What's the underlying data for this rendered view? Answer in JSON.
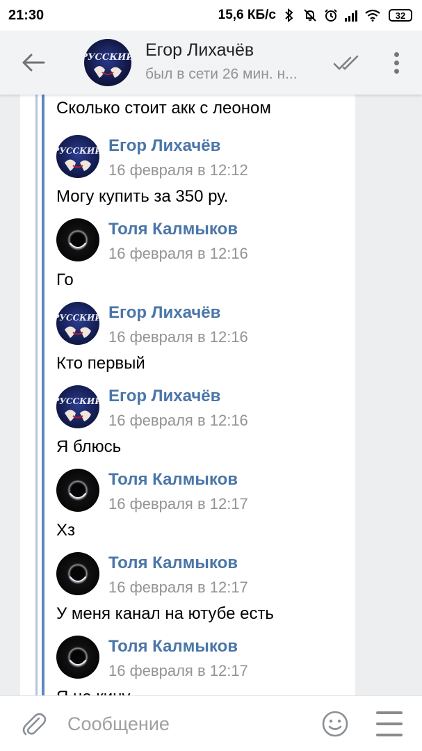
{
  "status_bar": {
    "time": "21:30",
    "network_speed": "15,6 КБ/с",
    "battery": "32",
    "icons": [
      "bluetooth-icon",
      "mute-icon",
      "alarm-icon",
      "signal-icon",
      "wifi-icon",
      "battery-icon"
    ]
  },
  "header": {
    "contact_name": "Егор Лихачёв",
    "contact_status": "был в сети 26 мин. н...",
    "avatar_text": "РУССКИЙ"
  },
  "chat": {
    "partial_top_text": "Сколько стоит акк с леоном",
    "messages": [
      {
        "author": "Егор Лихачёв",
        "date": "16 февраля в 12:12",
        "text": "Могу купить за 350 ру.",
        "avatar": "egor"
      },
      {
        "author": "Толя Калмыков",
        "date": "16 февраля в 12:16",
        "text": "Го",
        "avatar": "tolya"
      },
      {
        "author": "Егор Лихачёв",
        "date": "16 февраля в 12:16",
        "text": "Кто первый",
        "avatar": "egor"
      },
      {
        "author": "Егор Лихачёв",
        "date": "16 февраля в 12:16",
        "text": "Я блюсь",
        "avatar": "egor"
      },
      {
        "author": "Толя Калмыков",
        "date": "16 февраля в 12:17",
        "text": "Хз",
        "avatar": "tolya"
      },
      {
        "author": "Толя Калмыков",
        "date": "16 февраля в 12:17",
        "text": "У меня канал на ютубе есть",
        "avatar": "tolya"
      },
      {
        "author": "Толя Калмыков",
        "date": "16 февраля в 12:17",
        "text": "Я не кину",
        "avatar": "tolya"
      }
    ]
  },
  "composer": {
    "placeholder": "Сообщение",
    "value": ""
  },
  "colors": {
    "accent": "#4a76a8",
    "header_bg": "#f2f3f5",
    "chat_bg": "#edeef0",
    "forward_line": "#5b88bd"
  }
}
